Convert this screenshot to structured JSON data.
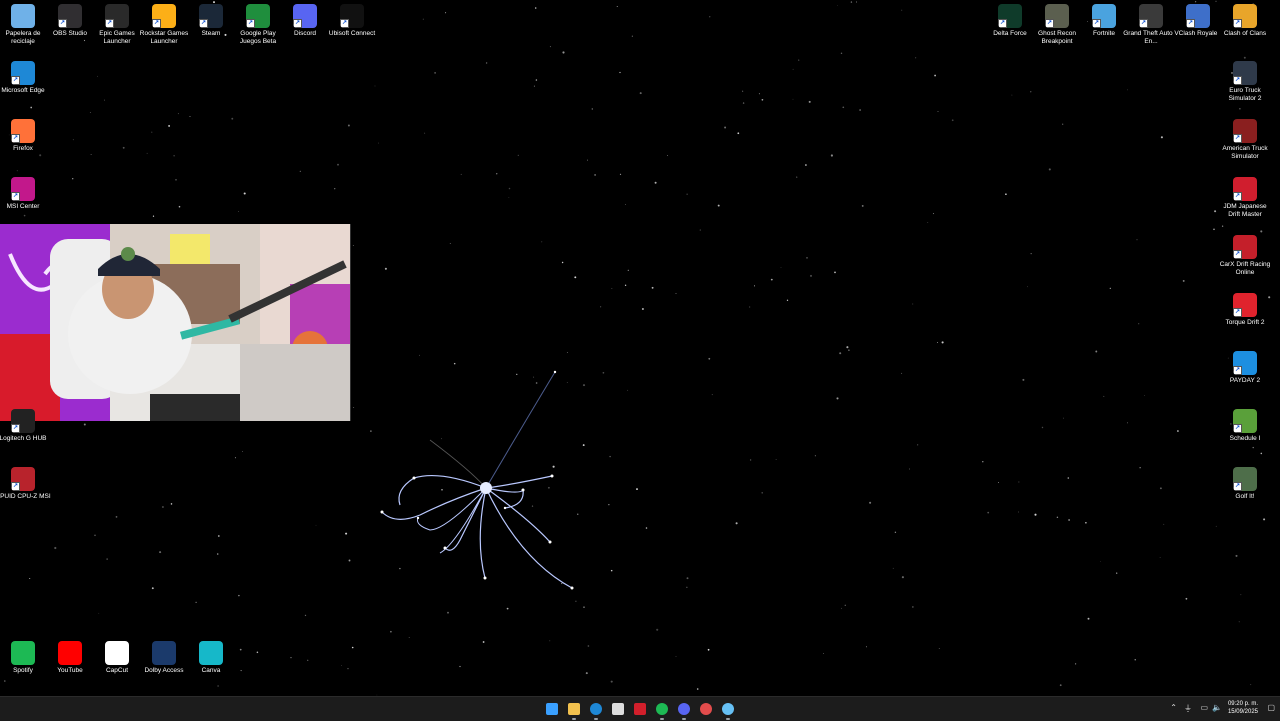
{
  "desktop": {
    "left_column_top": [
      {
        "label": "Papelera de reciclaje",
        "icon": "recycle-bin-icon",
        "color": "#6fb1e8"
      },
      {
        "label": "OBS Studio",
        "icon": "obs-icon",
        "color": "#302e31"
      },
      {
        "label": "Epic Games Launcher",
        "icon": "epic-games-icon",
        "color": "#2a2a2a"
      },
      {
        "label": "Rockstar Games Launcher",
        "icon": "rockstar-icon",
        "color": "#fcaf17"
      },
      {
        "label": "Steam",
        "icon": "steam-icon",
        "color": "#1b2838"
      },
      {
        "label": "Google Play Juegos Beta",
        "icon": "google-play-games-icon",
        "color": "#1f8e3d"
      },
      {
        "label": "Discord",
        "icon": "discord-icon",
        "color": "#5865f2"
      },
      {
        "label": "Ubisoft Connect",
        "icon": "ubisoft-icon",
        "color": "#111111"
      }
    ],
    "left_column": [
      {
        "label": "Microsoft Edge",
        "icon": "edge-icon",
        "color": "#1e88d6"
      },
      {
        "label": "Firefox",
        "icon": "firefox-icon",
        "color": "#ff7139"
      },
      {
        "label": "MSI Center",
        "icon": "msi-center-icon",
        "color": "#c2188b"
      },
      {
        "label": "Logitech G HUB",
        "icon": "logitech-icon",
        "color": "#222222"
      },
      {
        "label": "CPUID CPU-Z MSI",
        "icon": "cpuz-icon",
        "color": "#b8232c"
      }
    ],
    "right_top": [
      {
        "label": "Delta Force",
        "icon": "delta-force-icon",
        "color": "#0f3b2a"
      },
      {
        "label": "Ghost Recon Breakpoint",
        "icon": "ghost-recon-icon",
        "color": "#5b5f4f"
      },
      {
        "label": "Fortnite",
        "icon": "fortnite-icon",
        "color": "#4aa3df"
      },
      {
        "label": "Grand Theft Auto V En...",
        "icon": "gta-icon",
        "color": "#3a3a3a"
      },
      {
        "label": "Clash Royale",
        "icon": "clash-royale-icon",
        "color": "#3e6fc9"
      },
      {
        "label": "Clash of Clans",
        "icon": "clash-of-clans-icon",
        "color": "#e8a52a"
      }
    ],
    "right_column": [
      {
        "label": "Euro Truck Simulator 2",
        "icon": "euro-truck-icon",
        "color": "#2f3a4a"
      },
      {
        "label": "American Truck Simulator",
        "icon": "american-truck-icon",
        "color": "#8a1f1f"
      },
      {
        "label": "JDM Japanese Drift Master",
        "icon": "jdm-icon",
        "color": "#d01e2e"
      },
      {
        "label": "CarX Drift Racing Online",
        "icon": "carx-icon",
        "color": "#c41f2a"
      },
      {
        "label": "Torque Drift 2",
        "icon": "torque-drift-icon",
        "color": "#e0232d"
      },
      {
        "label": "PAYDAY 2",
        "icon": "payday-icon",
        "color": "#1d8fe0"
      },
      {
        "label": "Schedule I",
        "icon": "schedule-icon",
        "color": "#5aa03a"
      },
      {
        "label": "Golf It!",
        "icon": "golf-it-icon",
        "color": "#4e6e4a"
      }
    ],
    "bottom_row": [
      {
        "label": "Spotify",
        "icon": "spotify-icon",
        "color": "#1db954"
      },
      {
        "label": "YouTube",
        "icon": "youtube-icon",
        "color": "#ff0000"
      },
      {
        "label": "CapCut",
        "icon": "capcut-icon",
        "color": "#ffffff"
      },
      {
        "label": "Dolby Access",
        "icon": "dolby-icon",
        "color": "#1b3a6b"
      },
      {
        "label": "Canva",
        "icon": "canva-icon",
        "color": "#16b8c9"
      }
    ]
  },
  "taskbar": {
    "apps": [
      {
        "name": "start",
        "icon": "windows-start-icon",
        "color": "#3aa0ff"
      },
      {
        "name": "file-explorer",
        "icon": "folder-icon",
        "color": "#f2c14e"
      },
      {
        "name": "edge",
        "icon": "edge-icon",
        "color": "#1e88d6"
      },
      {
        "name": "store",
        "icon": "store-icon",
        "color": "#dddddd"
      },
      {
        "name": "app-red",
        "icon": "red-app-icon",
        "color": "#d21f2b"
      },
      {
        "name": "spotify",
        "icon": "spotify-icon",
        "color": "#1db954"
      },
      {
        "name": "discord",
        "icon": "discord-icon",
        "color": "#5865f2"
      },
      {
        "name": "app-circle",
        "icon": "red-circle-app-icon",
        "color": "#e24c4c"
      },
      {
        "name": "steam",
        "icon": "steam-icon",
        "color": "#66c0f4"
      }
    ],
    "time": "09:20 p. m.",
    "date": "15/09/2025"
  }
}
